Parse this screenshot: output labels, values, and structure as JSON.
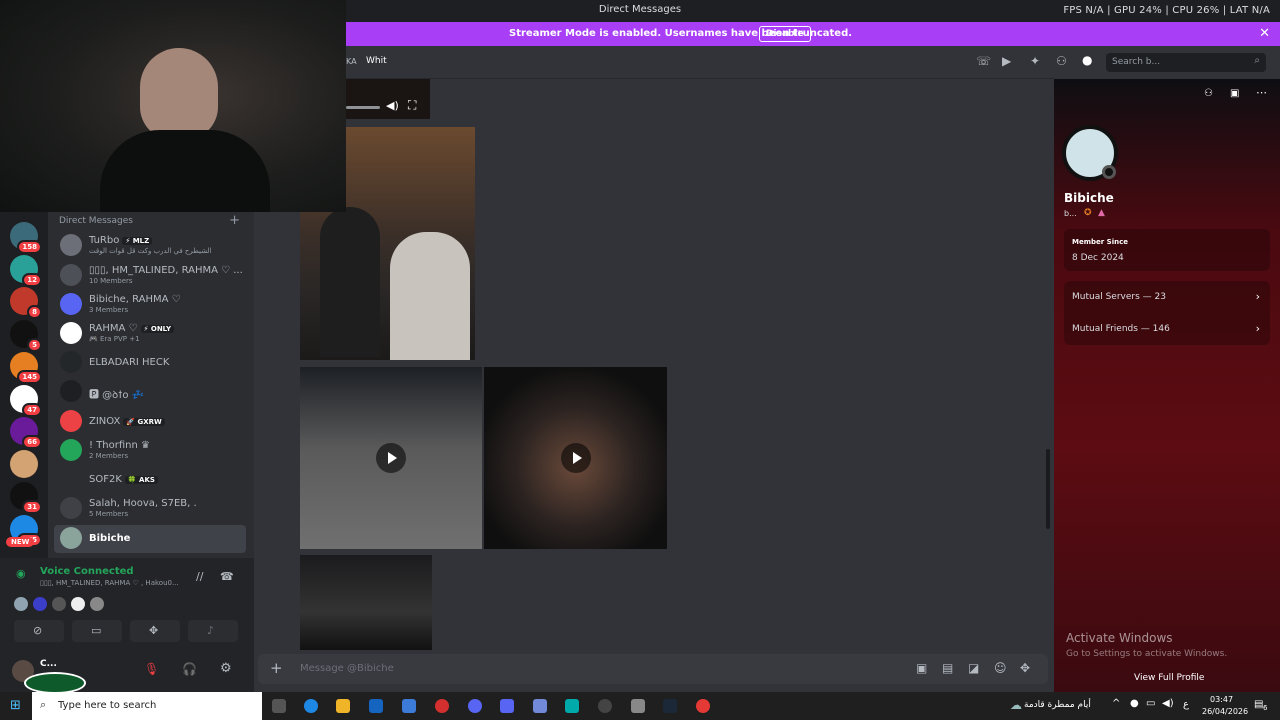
{
  "window": {
    "title": "Direct Messages",
    "stats": "FPS N/A | GPU 24% | CPU 26% | LAT N/A"
  },
  "banner": {
    "message": "Streamer Mode is enabled. Usernames have been truncated.",
    "button": "Disable"
  },
  "header": {
    "tab_a": "KA",
    "tab_b": "Whit",
    "search_placeholder": "Search b..."
  },
  "servers": [
    {
      "badge": "158",
      "color": "#3b6b7a"
    },
    {
      "badge": "12",
      "color": "#2aa198"
    },
    {
      "badge": "8",
      "color": "#c0392b"
    },
    {
      "badge": "5",
      "color": "#111111"
    },
    {
      "badge": "145",
      "color": "#e67e22"
    },
    {
      "badge": "47",
      "color": "#ffffff"
    },
    {
      "badge": "66",
      "color": "#6a1b9a"
    },
    {
      "badge": "",
      "color": "#d4a373"
    },
    {
      "badge": "31",
      "color": "#111111"
    },
    {
      "badge": "175",
      "color": "#1e88e5"
    }
  ],
  "new_badge": "NEW",
  "dm_list": {
    "heading": "Direct Messages",
    "items": [
      {
        "name": "TuRbo",
        "tag": "⚡ MLZ",
        "sub": "الشيطرح في الدرب وكت قل قوات الوقت",
        "color": "#6d6f78"
      },
      {
        "name": "▯▯▯, HM_TALINED, RAHMA ♡ ...",
        "tag": "",
        "sub": "10 Members",
        "color": "#4e5058"
      },
      {
        "name": "Bibiche, RAHMA ♡",
        "tag": "",
        "sub": "3 Members",
        "color": "#5865f2"
      },
      {
        "name": "RAHMA ♡",
        "tag": "⚡ ONLY",
        "sub": "🎮 Era PVP +1",
        "color": "#ffffff"
      },
      {
        "name": "ELBADARI HECK",
        "tag": "",
        "sub": "",
        "color": "#23272a"
      },
      {
        "name": "🅿 @ꝺꝉo 💤",
        "tag": "",
        "sub": "",
        "color": "#1e1f22"
      },
      {
        "name": "ZINOX",
        "tag": "🚀 GXRW",
        "sub": "",
        "color": "#ed4245"
      },
      {
        "name": "! Thorfinn ♛",
        "tag": "",
        "sub": "2 Members",
        "color": "#23a55a"
      },
      {
        "name": "SOF2K",
        "tag": "🍀 AKS",
        "sub": "",
        "color": "#2b2d31"
      },
      {
        "name": "Salah, Hoova, S7EB, .",
        "tag": "",
        "sub": "5 Members",
        "color": "#3f4147"
      },
      {
        "name": "Bibiche",
        "tag": "",
        "sub": "",
        "color": "#8aa39b"
      }
    ]
  },
  "voice": {
    "status": "Voice Connected",
    "channel": "▯▯▯, HM_TALINED, RAHMA ♡ , Hakou0..."
  },
  "user": {
    "name": "C..."
  },
  "composer": {
    "placeholder": "Message @Bibiche"
  },
  "profile": {
    "name": "Bibiche",
    "handle": "b...",
    "member_since_label": "Member Since",
    "member_since": "8 Dec 2024",
    "mutual_servers": "Mutual Servers — 23",
    "mutual_friends": "Mutual Friends — 146",
    "view_full": "View Full Profile"
  },
  "watermark": {
    "title": "Activate Windows",
    "sub": "Go to Settings to activate Windows."
  },
  "taskbar": {
    "search": "Type here to search",
    "weather": "أيام ممطرة قادمة",
    "lang": "ع",
    "time": "03:47",
    "date": "26/04/2026",
    "notif": "6"
  }
}
